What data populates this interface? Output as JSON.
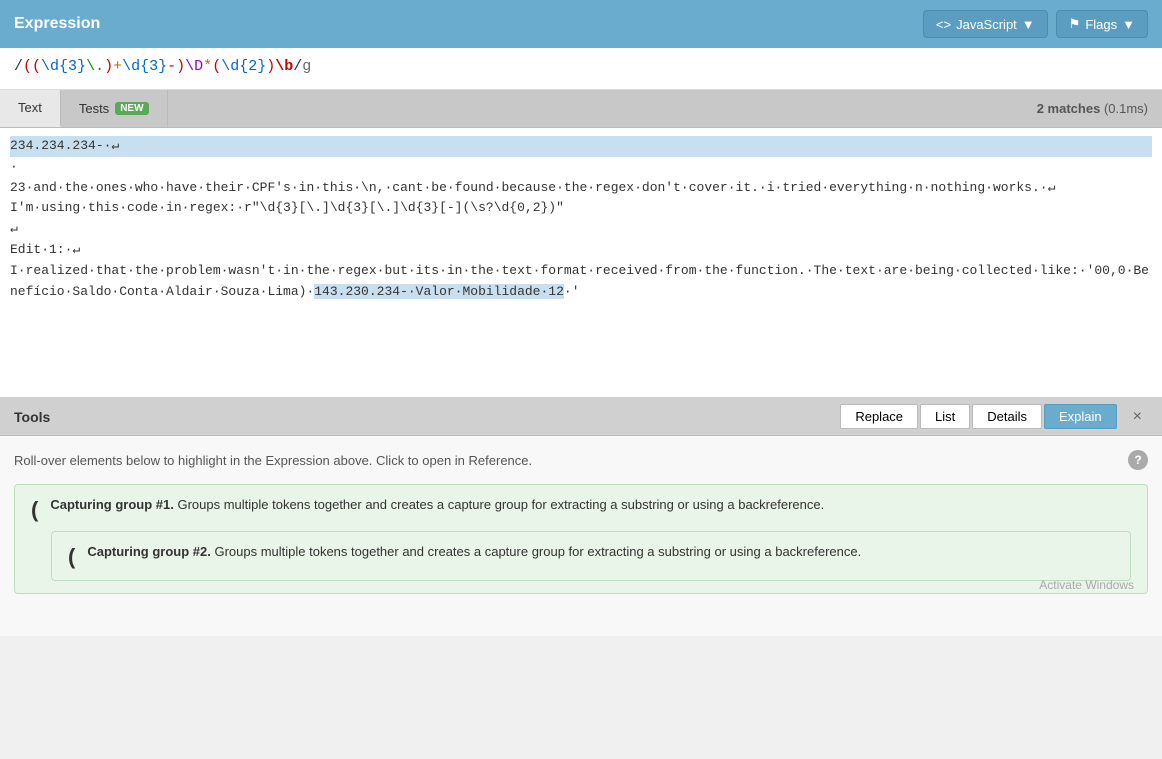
{
  "header": {
    "title": "Expression",
    "js_button": "JavaScript",
    "flags_button": "Flags"
  },
  "expression": {
    "full": "/((\\d{3}\\.)+ \\d{3}-) \\D*(\\d{2})\\b/g",
    "parts": [
      {
        "type": "slash",
        "text": "/"
      },
      {
        "type": "paren-open",
        "text": "("
      },
      {
        "type": "paren-open",
        "text": "("
      },
      {
        "type": "group1",
        "text": "\\d{3}"
      },
      {
        "type": "dot",
        "text": "\\."
      },
      {
        "type": "paren-close",
        "text": ")"
      },
      {
        "type": "plus",
        "text": "+"
      },
      {
        "type": "group2",
        "text": "\\d{3}"
      },
      {
        "type": "dash",
        "text": "-"
      },
      {
        "type": "paren-close",
        "text": ")"
      },
      {
        "type": "D",
        "text": "\\D"
      },
      {
        "type": "star",
        "text": "*"
      },
      {
        "type": "paren-open",
        "text": "("
      },
      {
        "type": "group3",
        "text": "\\d{2}"
      },
      {
        "type": "paren-close",
        "text": ")"
      },
      {
        "type": "b",
        "text": "\\b"
      },
      {
        "type": "slash",
        "text": "/"
      },
      {
        "type": "flag",
        "text": "g"
      }
    ]
  },
  "tabs": {
    "text_label": "Text",
    "tests_label": "Tests",
    "new_badge": "NEW",
    "matches_label": "2 matches",
    "matches_time": "(0.1ms)"
  },
  "text_content": {
    "lines": "234.234.234-\n\n23·and·the·ones·who·have·their·CPF's·in·this·\\n,·cant·be·found·because·the·regex·don't·cover·it.·i·tried·everything·n·nothing·works.·↵\nI'm·using·this·code·in·regex:·r\"\\d{3}[\\.] \\d{3}[\\.] \\d{3}[-](\\s?\\d{0,2})\"\n\nEdit·1:·↵\nI·realized·that·the·problem·wasn't·in·the·regex·but·its·in·the·text·format·received·from·the·function.·The·text·are·being·collected·like:·'00,0·Benefício·Saldo·Conta·Aldair·Souza·Lima)·143.230.234-·Valor·Mobilidade·12·'"
  },
  "tools": {
    "title": "Tools",
    "buttons": [
      "Replace",
      "List",
      "Details",
      "Explain"
    ],
    "active_button": "Explain",
    "rollover_hint": "Roll-over elements below to highlight in the Expression above. Click to open in Reference.",
    "close_label": "×"
  },
  "explain": {
    "group1": {
      "paren": "(",
      "title": "Capturing group #1.",
      "description": "Groups multiple tokens together and creates a capture group for extracting a substring or using a backreference."
    },
    "group2": {
      "paren": "(",
      "title": "Capturing group #2.",
      "description": "Groups multiple tokens together and creates a capture group for extracting a substring or using a backreference."
    }
  },
  "watermark": "Activate Windows"
}
